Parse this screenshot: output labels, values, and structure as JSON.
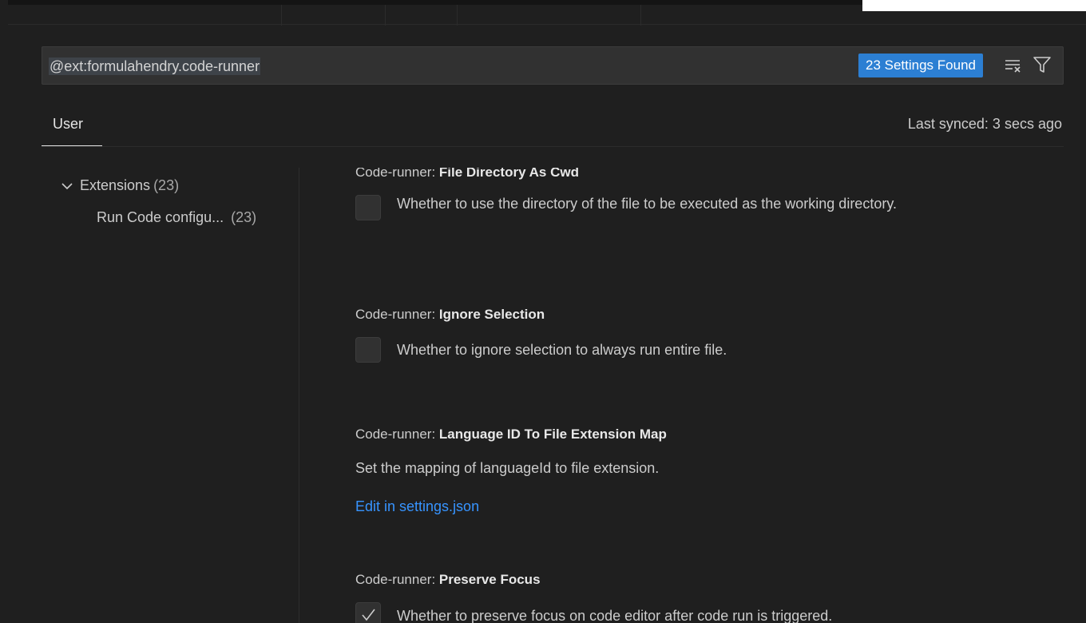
{
  "search": {
    "query": "@ext:formulahendry.code-runner",
    "results_badge": "23 Settings Found",
    "clear_icon": "clear-filter-icon",
    "filter_icon": "filter-icon"
  },
  "scope": {
    "user_tab": "User",
    "last_synced": "Last synced: 3 secs ago"
  },
  "toc": {
    "extensions_label": "Extensions",
    "extensions_count": "(23)",
    "sub_label": "Run Code configu...",
    "sub_count": "(23)"
  },
  "settings": [
    {
      "category": "Code-runner: ",
      "name": "File Directory As Cwd",
      "type": "checkbox",
      "checked": false,
      "description": "Whether to use the directory of the file to be executed as the working directory."
    },
    {
      "category": "Code-runner: ",
      "name": "Ignore Selection",
      "type": "checkbox",
      "checked": false,
      "description": "Whether to ignore selection to always run entire file."
    },
    {
      "category": "Code-runner: ",
      "name": "Language ID To File Extension Map",
      "type": "json",
      "description": "Set the mapping of languageId to file extension.",
      "link": "Edit in settings.json"
    },
    {
      "category": "Code-runner: ",
      "name": "Preserve Focus",
      "type": "checkbox",
      "checked": true,
      "description": "Whether to preserve focus on code editor after code run is triggered."
    }
  ],
  "colors": {
    "accent": "#2c7fd3",
    "link": "#3794ff",
    "background": "#1f1f1f"
  }
}
